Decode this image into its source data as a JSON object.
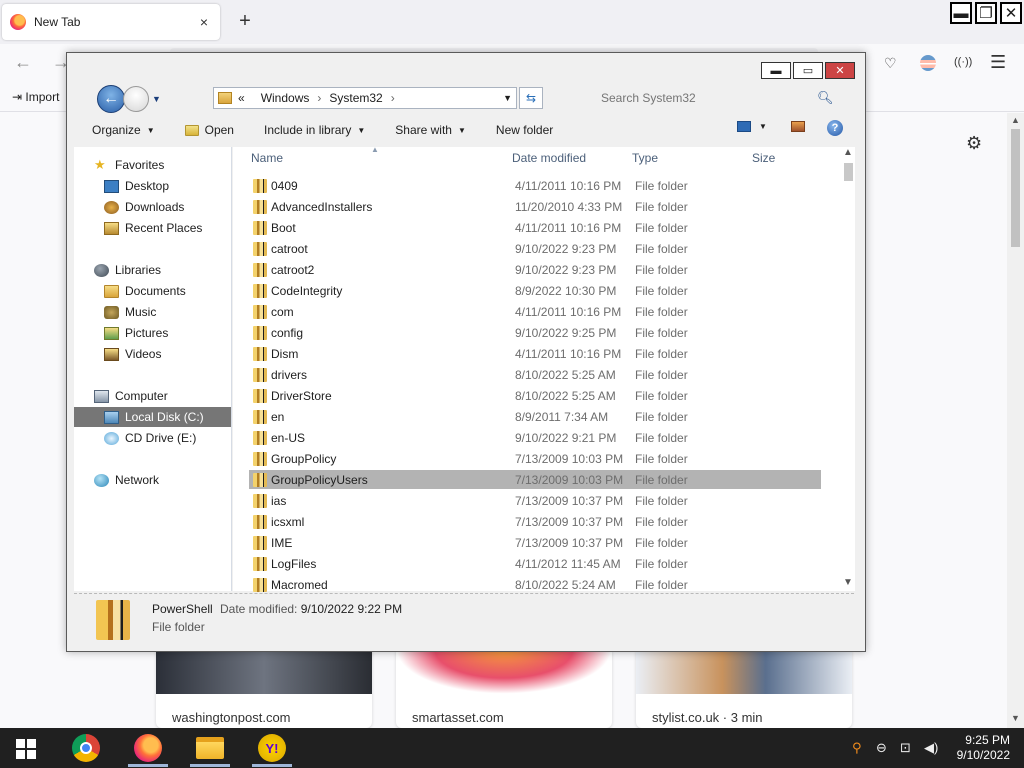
{
  "firefox": {
    "tab_title": "New Tab",
    "tab_close": "×",
    "new_tab": "+",
    "import_label": "Import",
    "back": "←",
    "forward": "→",
    "menu": "☰",
    "gear": "⚙",
    "cards": [
      {
        "site": "washingtonpost.com"
      },
      {
        "site": "smartasset.com"
      },
      {
        "site": "stylist.co.uk · 3 min"
      }
    ]
  },
  "window_controls": {
    "minimize": "▬",
    "restore": "❐",
    "close": "✕"
  },
  "explorer": {
    "caption": {
      "minimize": "▬",
      "maximize": "▭",
      "close": "✕"
    },
    "breadcrumb": {
      "chevron": "«",
      "part1": "Windows",
      "sep": "›",
      "part2": "System32",
      "sep2": "›"
    },
    "search_placeholder": "Search System32",
    "toolbar": {
      "organize": "Organize",
      "open": "Open",
      "include_in_library": "Include in library",
      "share_with": "Share with",
      "new_folder": "New folder",
      "help": "?"
    },
    "columns": {
      "name": "Name",
      "date_modified": "Date modified",
      "type": "Type",
      "size": "Size"
    },
    "nav": {
      "favorites": "Favorites",
      "desktop": "Desktop",
      "downloads": "Downloads",
      "recent_places": "Recent Places",
      "libraries": "Libraries",
      "documents": "Documents",
      "music": "Music",
      "pictures": "Pictures",
      "videos": "Videos",
      "computer": "Computer",
      "local_disk": "Local Disk (C:)",
      "cd_drive": "CD Drive (E:)",
      "network": "Network"
    },
    "files": [
      {
        "name": "0409",
        "date": "4/11/2011 10:16 PM",
        "type": "File folder"
      },
      {
        "name": "AdvancedInstallers",
        "date": "11/20/2010 4:33 PM",
        "type": "File folder"
      },
      {
        "name": "Boot",
        "date": "4/11/2011 10:16 PM",
        "type": "File folder"
      },
      {
        "name": "catroot",
        "date": "9/10/2022 9:23 PM",
        "type": "File folder"
      },
      {
        "name": "catroot2",
        "date": "9/10/2022 9:23 PM",
        "type": "File folder"
      },
      {
        "name": "CodeIntegrity",
        "date": "8/9/2022 10:30 PM",
        "type": "File folder"
      },
      {
        "name": "com",
        "date": "4/11/2011 10:16 PM",
        "type": "File folder"
      },
      {
        "name": "config",
        "date": "9/10/2022 9:25 PM",
        "type": "File folder"
      },
      {
        "name": "Dism",
        "date": "4/11/2011 10:16 PM",
        "type": "File folder"
      },
      {
        "name": "drivers",
        "date": "8/10/2022 5:25 AM",
        "type": "File folder"
      },
      {
        "name": "DriverStore",
        "date": "8/10/2022 5:25 AM",
        "type": "File folder"
      },
      {
        "name": "en",
        "date": "8/9/2011 7:34 AM",
        "type": "File folder"
      },
      {
        "name": "en-US",
        "date": "9/10/2022 9:21 PM",
        "type": "File folder"
      },
      {
        "name": "GroupPolicy",
        "date": "7/13/2009 10:03 PM",
        "type": "File folder"
      },
      {
        "name": "GroupPolicyUsers",
        "date": "7/13/2009 10:03 PM",
        "type": "File folder"
      },
      {
        "name": "ias",
        "date": "7/13/2009 10:37 PM",
        "type": "File folder"
      },
      {
        "name": "icsxml",
        "date": "7/13/2009 10:37 PM",
        "type": "File folder"
      },
      {
        "name": "IME",
        "date": "7/13/2009 10:37 PM",
        "type": "File folder"
      },
      {
        "name": "LogFiles",
        "date": "4/11/2012 11:45 AM",
        "type": "File folder"
      },
      {
        "name": "Macromed",
        "date": "8/10/2022 5:24 AM",
        "type": "File folder"
      }
    ],
    "selected_row": 14,
    "details": {
      "name": "PowerShell",
      "modified_label": "Date modified:",
      "modified_value": "9/10/2022 9:22 PM",
      "type": "File folder"
    }
  },
  "taskbar": {
    "clock_time": "9:25 PM",
    "clock_date": "9/10/2022",
    "yahoo_letter": "Y!"
  }
}
